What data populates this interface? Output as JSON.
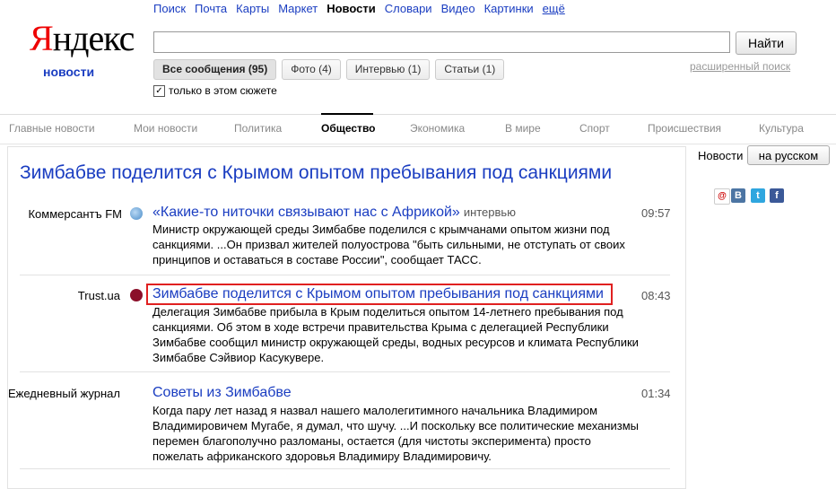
{
  "logo": {
    "first_letter": "Я",
    "rest": "ндекс",
    "subtitle": "новости"
  },
  "top_nav": [
    "Поиск",
    "Почта",
    "Карты",
    "Маркет",
    "Новости",
    "Словари",
    "Видео",
    "Картинки",
    "ещё"
  ],
  "search": {
    "value": "",
    "placeholder": "",
    "button": "Найти",
    "advanced": "расширенный поиск"
  },
  "filters": [
    "Все сообщения (95)",
    "Фото (4)",
    "Интервью (1)",
    "Статьи (1)"
  ],
  "checkbox": {
    "label": "только в этом сюжете",
    "checked": true
  },
  "category_nav": [
    "Главные новости",
    "Мои новости",
    "Политика",
    "Общество",
    "Экономика",
    "В мире",
    "Спорт",
    "Происшествия",
    "Культура"
  ],
  "story": {
    "title": "Зимбабве поделится с Крымом опытом пребывания под санкциями"
  },
  "items": [
    {
      "source": "Коммерсантъ FM",
      "headline": "«Какие-то ниточки связывают нас с Африкой»",
      "tag": "интервью",
      "time": "09:57",
      "snippet": "Министр окружающей среды Зимбабве поделился с крымчанами опытом жизни под санкциями. ...Он призвал жителей полуострова \"быть сильными, не отступать от своих принципов и оставаться в составе России\", сообщает ТАСС."
    },
    {
      "source": "Trust.ua",
      "headline": "Зимбабве поделится с Крымом опытом пребывания под санкциями",
      "tag": "",
      "time": "08:43",
      "snippet": "Делегация Зимбабве прибыла в Крым поделиться опытом 14-летнего пребывания под санкциями. Об этом в ходе встречи правительства Крыма с делегацией Республики Зимбабве сообщил министр окружающей среды, водных ресурсов и климата Республики Зимбабве Сэйвиор Касукувере."
    },
    {
      "source": "Ежедневный журнал",
      "headline": "Советы из Зимбабве",
      "tag": "",
      "time": "01:34",
      "snippet": "Когда пару лет назад я назвал нашего малолегитимного начальника Владимиром Владимировичем Мугабе, я думал, что шучу. ...И поскольку все политические механизмы перемен благополучно разломаны, остается (для чистоты эксперимента) просто пожелать африканского здоровья Владимиру Владимировичу."
    }
  ],
  "right": {
    "label": "Новости",
    "button": "на русском"
  },
  "colors": {
    "link": "#1a3dc1",
    "logo_red": "#e00000",
    "highlight": "#e02020"
  }
}
